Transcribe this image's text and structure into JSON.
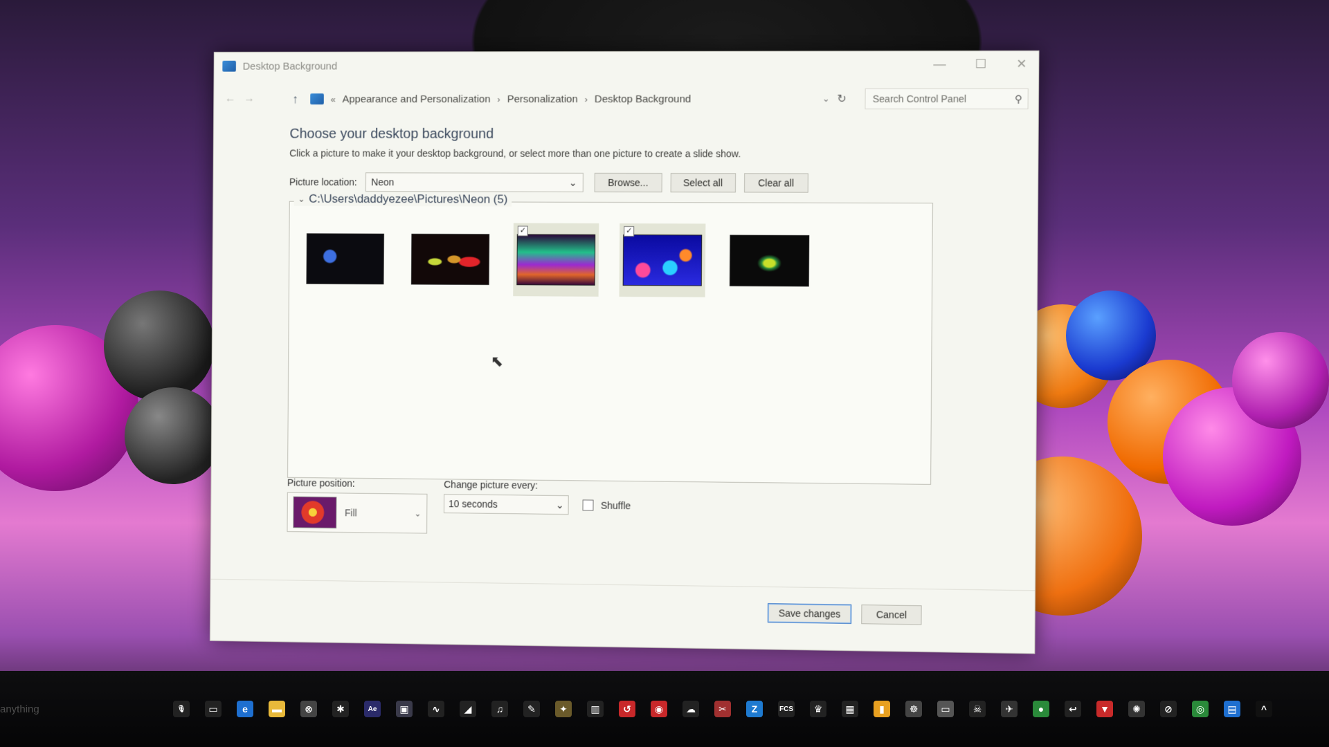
{
  "window": {
    "title": "Desktop Background",
    "controls": {
      "minimize": "—",
      "maximize": "☐",
      "close": "✕"
    }
  },
  "navbar": {
    "back": "←",
    "forward": "→",
    "up": "↑",
    "overflow": "«",
    "breadcrumb": [
      "Appearance and Personalization",
      "Personalization",
      "Desktop Background"
    ],
    "separator": "›",
    "dropdown": "⌄",
    "refresh": "↻",
    "search_placeholder": "Search Control Panel",
    "search_glyph": "⚲"
  },
  "content": {
    "title": "Choose your desktop background",
    "description": "Click a picture to make it your desktop background, or select more than one picture to create a slide show.",
    "location_label": "Picture location:",
    "location_value": "Neon",
    "dropdown_glyph": "⌄",
    "browse_label": "Browse...",
    "select_all_label": "Select all",
    "clear_all_label": "Clear all",
    "group_chevron": "⌄",
    "group_title": "C:\\Users\\daddyezee\\Pictures\\Neon (5)",
    "checkmark": "✓",
    "thumbnails": [
      {
        "selected": false
      },
      {
        "selected": false
      },
      {
        "selected": true
      },
      {
        "selected": true
      },
      {
        "selected": false
      }
    ],
    "cursor_glyph": "⬉"
  },
  "options": {
    "position_label": "Picture position:",
    "position_value": "Fill",
    "interval_label": "Change picture every:",
    "interval_value": "10 seconds",
    "shuffle_label": "Shuffle",
    "shuffle_checked": false
  },
  "footer": {
    "save_label": "Save changes",
    "cancel_label": "Cancel"
  },
  "taskbar": {
    "search_text": "anything",
    "icons": [
      {
        "name": "mic-icon",
        "glyph": "🎙",
        "color": "#222"
      },
      {
        "name": "task-view-icon",
        "glyph": "▭",
        "color": "#222"
      },
      {
        "name": "edge-icon",
        "glyph": "e",
        "color": "#1e6fd0"
      },
      {
        "name": "folder-icon",
        "glyph": "▬",
        "color": "#e8b93a"
      },
      {
        "name": "xbox-icon",
        "glyph": "⊗",
        "color": "#444"
      },
      {
        "name": "app-icon-1",
        "glyph": "✱",
        "color": "#222"
      },
      {
        "name": "after-effects-icon",
        "glyph": "Ae",
        "color": "#2b2b6a"
      },
      {
        "name": "app-icon-2",
        "glyph": "▣",
        "color": "#3a3a4a"
      },
      {
        "name": "app-icon-3",
        "glyph": "∿",
        "color": "#222"
      },
      {
        "name": "app-icon-4",
        "glyph": "◢",
        "color": "#222"
      },
      {
        "name": "app-icon-5",
        "glyph": "♫",
        "color": "#222"
      },
      {
        "name": "app-icon-6",
        "glyph": "✎",
        "color": "#222"
      },
      {
        "name": "app-icon-7",
        "glyph": "✦",
        "color": "#6a5a2a"
      },
      {
        "name": "app-icon-8",
        "glyph": "▥",
        "color": "#222"
      },
      {
        "name": "app-icon-9",
        "glyph": "↺",
        "color": "#c8282a"
      },
      {
        "name": "app-icon-10",
        "glyph": "◉",
        "color": "#c8282a"
      },
      {
        "name": "app-icon-11",
        "glyph": "☁",
        "color": "#222"
      },
      {
        "name": "app-icon-12",
        "glyph": "✂",
        "color": "#a03030"
      },
      {
        "name": "app-icon-13",
        "glyph": "Z",
        "color": "#1e7ad0"
      },
      {
        "name": "app-icon-14",
        "glyph": "FCS",
        "color": "#222"
      },
      {
        "name": "app-icon-15",
        "glyph": "♛",
        "color": "#222"
      },
      {
        "name": "app-icon-16",
        "glyph": "▦",
        "color": "#222"
      },
      {
        "name": "app-icon-17",
        "glyph": "▮",
        "color": "#e8a020"
      },
      {
        "name": "app-icon-18",
        "glyph": "☸",
        "color": "#444"
      },
      {
        "name": "app-icon-19",
        "glyph": "▭",
        "color": "#555"
      },
      {
        "name": "app-icon-20",
        "glyph": "☠",
        "color": "#222"
      },
      {
        "name": "app-icon-21",
        "glyph": "✈",
        "color": "#333"
      },
      {
        "name": "app-icon-22",
        "glyph": "●",
        "color": "#2a8a3a"
      },
      {
        "name": "app-icon-23",
        "glyph": "↩",
        "color": "#222"
      },
      {
        "name": "app-icon-24",
        "glyph": "▼",
        "color": "#c82a2a"
      },
      {
        "name": "app-icon-25",
        "glyph": "✺",
        "color": "#333"
      },
      {
        "name": "app-icon-26",
        "glyph": "⊘",
        "color": "#222"
      },
      {
        "name": "chrome-icon",
        "glyph": "◎",
        "color": "#2a8a3a"
      },
      {
        "name": "control-panel-icon",
        "glyph": "▤",
        "color": "#1e6fd0"
      },
      {
        "name": "tray-chevron-icon",
        "glyph": "^",
        "color": "#111"
      }
    ]
  },
  "colors": {
    "window_bg": "#f5f6f0",
    "selected_tile": "#e3e5d6",
    "title_text": "#3c4a5e",
    "primary_button_border": "#3a78c8"
  }
}
